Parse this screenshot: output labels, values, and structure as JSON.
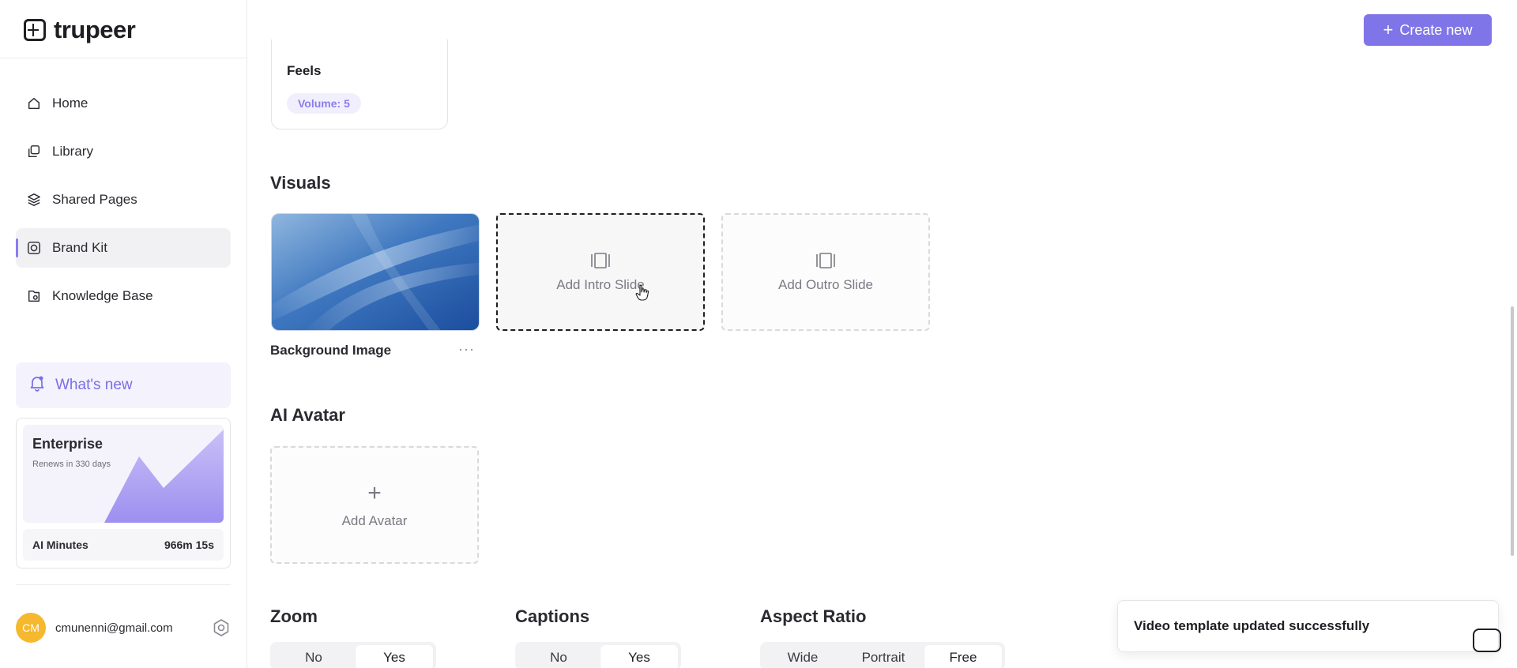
{
  "app": {
    "logo_text": "trupeer"
  },
  "sidebar": {
    "items": [
      {
        "label": "Home",
        "icon": "home-icon"
      },
      {
        "label": "Library",
        "icon": "library-icon"
      },
      {
        "label": "Shared Pages",
        "icon": "layers-icon"
      },
      {
        "label": "Brand Kit",
        "icon": "brand-kit-icon",
        "active": true
      },
      {
        "label": "Knowledge Base",
        "icon": "knowledge-icon"
      }
    ],
    "whats_new": "What's new",
    "plan": {
      "title": "Enterprise",
      "renews": "Renews in 330 days",
      "minutes_label": "AI Minutes",
      "minutes_value": "966m 15s"
    },
    "user": {
      "initials": "CM",
      "email": "cmunenni@gmail.com"
    }
  },
  "header": {
    "create_label": "Create new"
  },
  "voice": {
    "name": "Feels",
    "volume": "Volume: 5"
  },
  "visuals": {
    "title": "Visuals",
    "background_label": "Background Image",
    "intro_label": "Add Intro Slide",
    "outro_label": "Add Outro Slide"
  },
  "avatar": {
    "title": "AI Avatar",
    "add_label": "Add Avatar"
  },
  "zoom": {
    "title": "Zoom",
    "options": [
      "No",
      "Yes"
    ],
    "selected": "Yes"
  },
  "captions": {
    "title": "Captions",
    "options": [
      "No",
      "Yes"
    ],
    "selected": "Yes"
  },
  "aspect": {
    "title": "Aspect Ratio",
    "options": [
      "Wide",
      "Portrait",
      "Free"
    ],
    "selected": "Free"
  },
  "toast": {
    "message": "Video template updated successfully"
  },
  "colors": {
    "accent": "#8075e8",
    "avatar_bg": "#f5b82e",
    "active_bar": "#8a7cf0"
  }
}
